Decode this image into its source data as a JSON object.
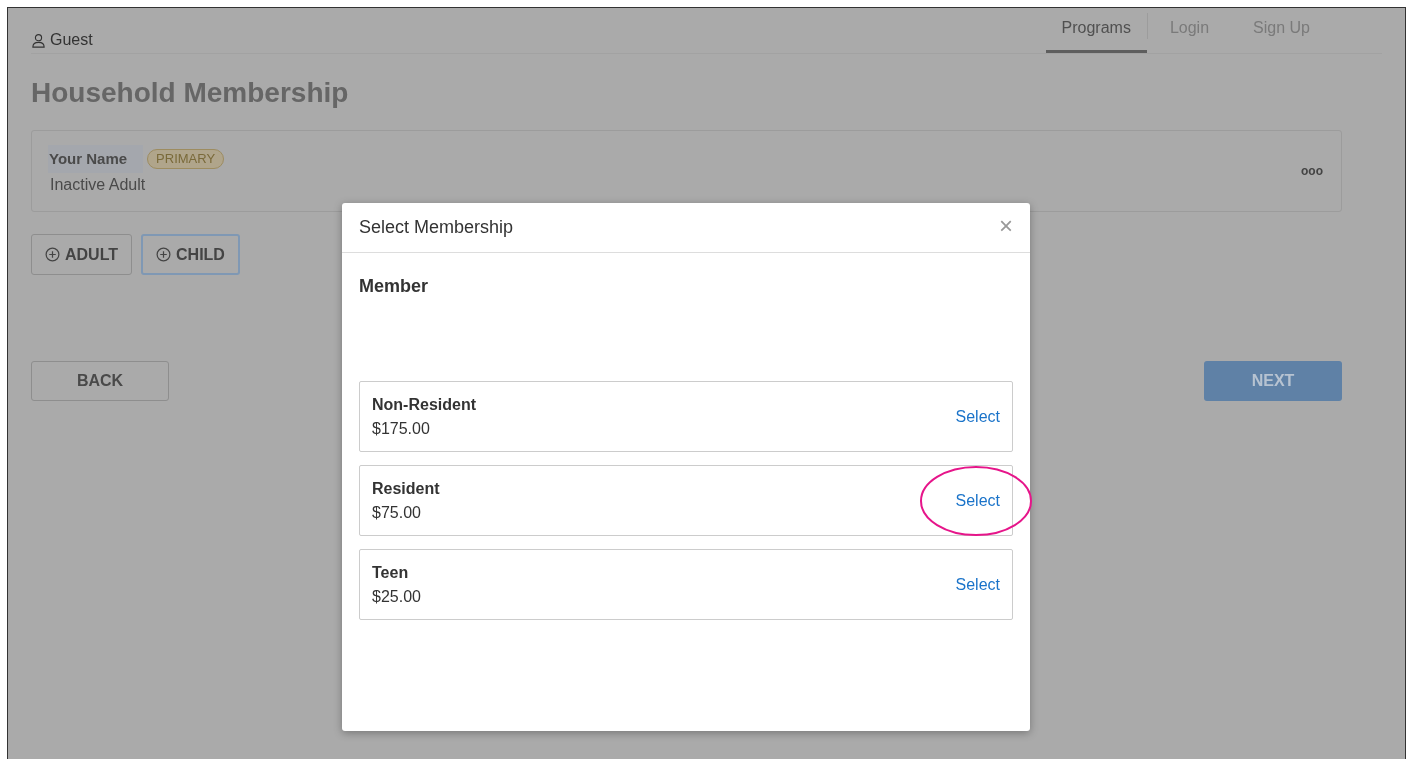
{
  "header": {
    "user": "Guest",
    "tabs": [
      {
        "label": "Programs",
        "selected": true
      },
      {
        "label": "Login",
        "selected": false
      },
      {
        "label": "Sign Up",
        "selected": false
      }
    ]
  },
  "page_title": "Household Membership",
  "member_card": {
    "name": "Your Name",
    "badge": "PRIMARY",
    "status": "Inactive Adult",
    "menu": "ooo"
  },
  "add_buttons": [
    {
      "label": "ADULT",
      "focused": false
    },
    {
      "label": "CHILD",
      "focused": true
    }
  ],
  "nav_buttons": [
    {
      "label": "BACK",
      "kind": "secondary"
    },
    {
      "label": "NEXT",
      "kind": "primary"
    }
  ],
  "modal": {
    "title": "Select Membership",
    "close": "×",
    "section": "Member",
    "options": [
      {
        "name": "Non-Resident",
        "price": "$175.00",
        "action": "Select",
        "highlighted": false
      },
      {
        "name": "Resident",
        "price": "$75.00",
        "action": "Select",
        "highlighted": true
      },
      {
        "name": "Teen",
        "price": "$25.00",
        "action": "Select",
        "highlighted": false
      }
    ]
  }
}
